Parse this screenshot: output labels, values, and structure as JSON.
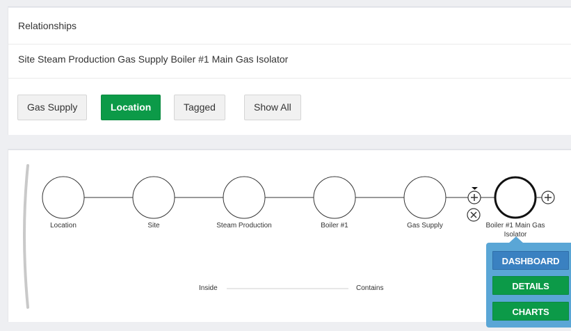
{
  "relationships": {
    "title": "Relationships",
    "path": "Site Steam Production Gas Supply Boiler #1 Main Gas Isolator",
    "filters": [
      {
        "label": "Gas Supply",
        "active": false
      },
      {
        "label": "Location",
        "active": true
      },
      {
        "label": "Tagged",
        "active": false
      },
      {
        "label": "Show All",
        "active": false
      }
    ]
  },
  "graph": {
    "nodes": [
      {
        "label": "Location"
      },
      {
        "label": "Site"
      },
      {
        "label": "Steam Production"
      },
      {
        "label": "Boiler #1"
      },
      {
        "label": "Gas Supply"
      },
      {
        "label_line1": "Boiler #1 Main Gas",
        "label_line2": "Isolator",
        "selected": true
      }
    ],
    "legend": {
      "left": "Inside",
      "right": "Contains"
    }
  },
  "popup": {
    "dashboard": "DASHBOARD",
    "details": "DETAILS",
    "charts": "CHARTS"
  },
  "colors": {
    "green": "#0c9a48",
    "blue": "#3a81c1",
    "popup_bg": "#5aa6d6"
  }
}
